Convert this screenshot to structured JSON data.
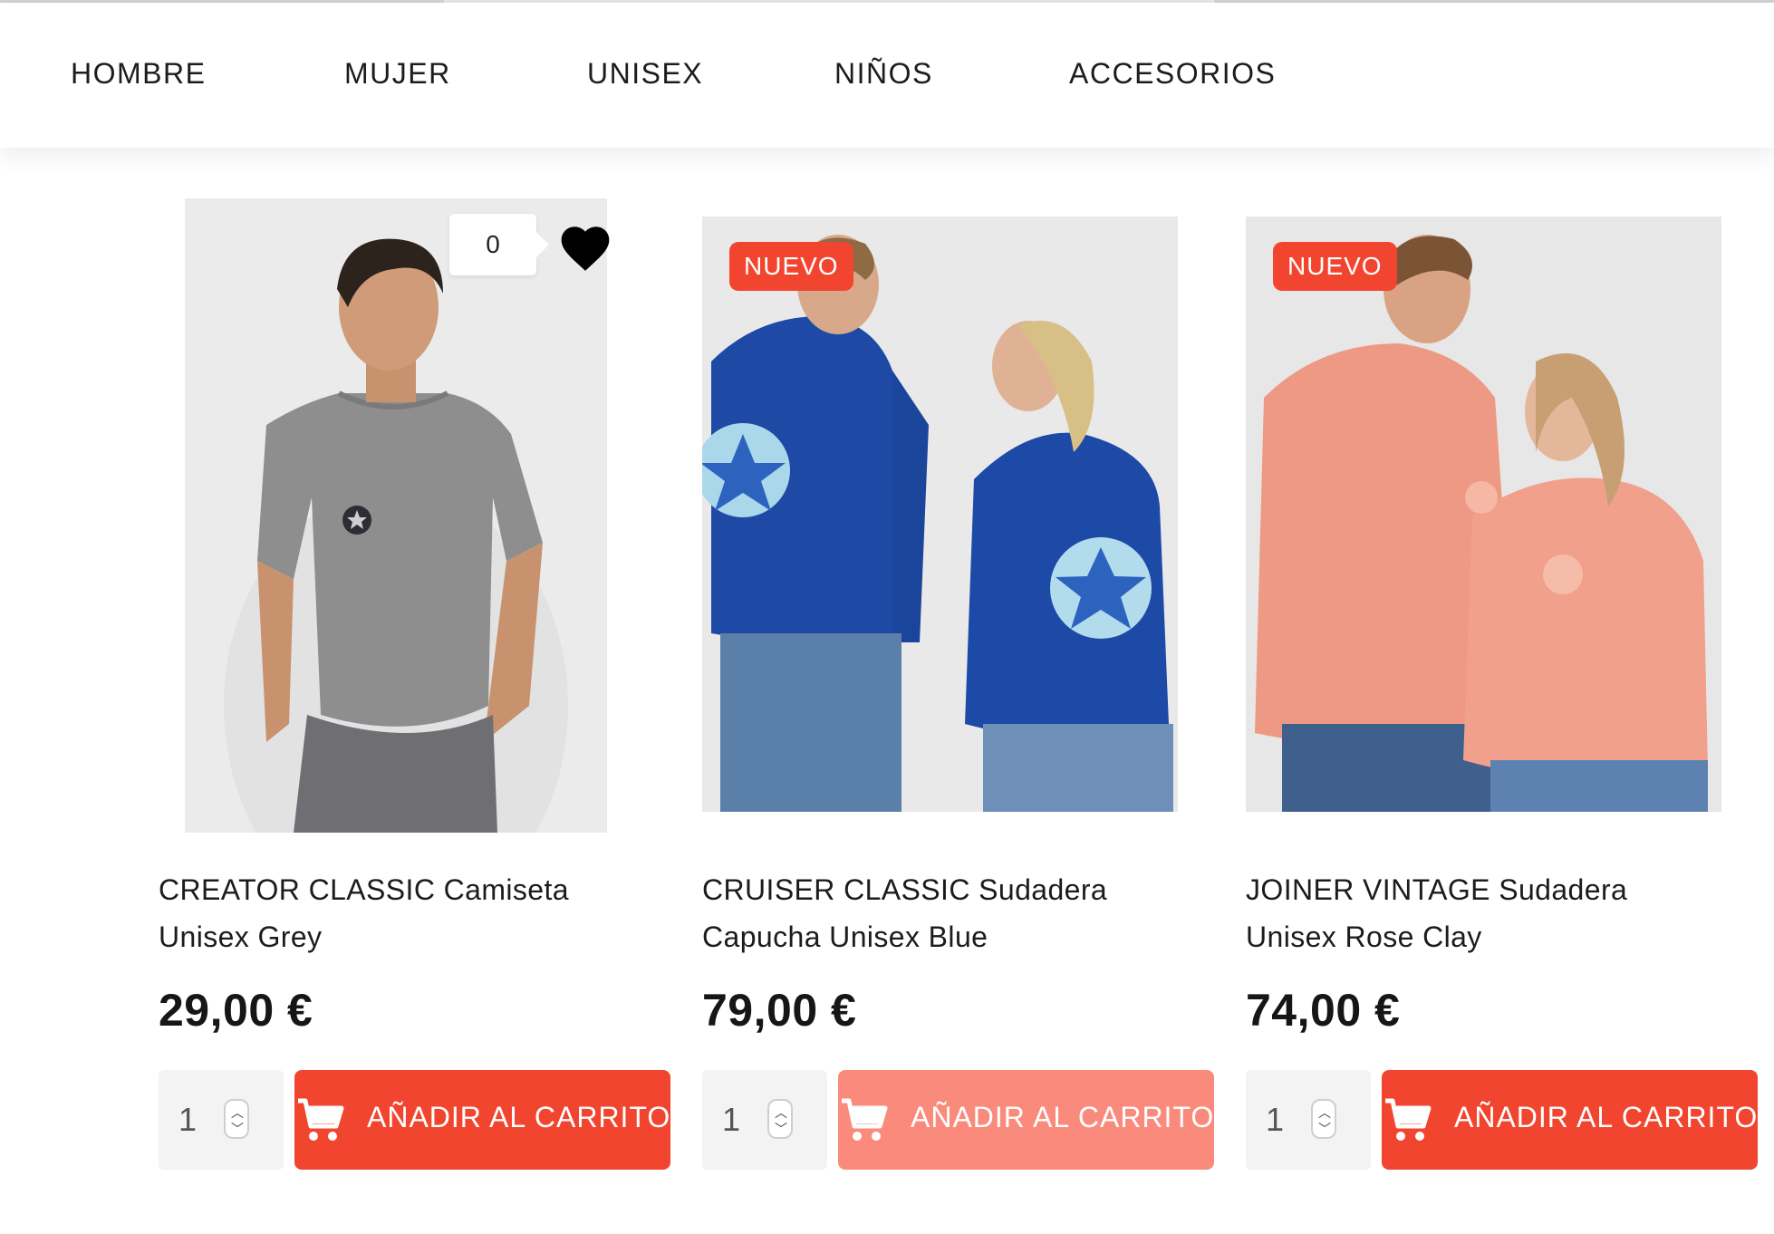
{
  "nav": {
    "items": [
      "HOMBRE",
      "MUJER",
      "UNISEX",
      "NIÑOS",
      "ACCESORIOS"
    ]
  },
  "wishlist": {
    "count": "0",
    "icon": "heart-icon"
  },
  "products": [
    {
      "name": "CREATOR CLASSIC Camiseta Unisex Grey",
      "name_line1": "CREATOR CLASSIC Camiseta",
      "name_line2": "Unisex Grey",
      "price": "29,00 €",
      "badge": "",
      "quantity": "1",
      "cart_label": "AÑADIR AL CARRITO"
    },
    {
      "name": "CRUISER CLASSIC Sudadera Capucha Unisex Blue",
      "name_line1": "CRUISER CLASSIC Sudadera",
      "name_line2": "Capucha Unisex Blue",
      "price": "79,00 €",
      "badge": "NUEVO",
      "quantity": "1",
      "cart_label": "AÑADIR AL CARRITO"
    },
    {
      "name": "JOINER VINTAGE Sudadera Unisex Rose Clay",
      "name_line1": "JOINER VINTAGE Sudadera",
      "name_line2": "Unisex Rose Clay",
      "price": "74,00 €",
      "badge": "NUEVO",
      "quantity": "1",
      "cart_label": "AÑADIR AL CARRITO"
    }
  ],
  "colors": {
    "accent": "#f2452f",
    "accent_hover": "#fa8b7c",
    "qty_bg": "#f3f3f3"
  }
}
